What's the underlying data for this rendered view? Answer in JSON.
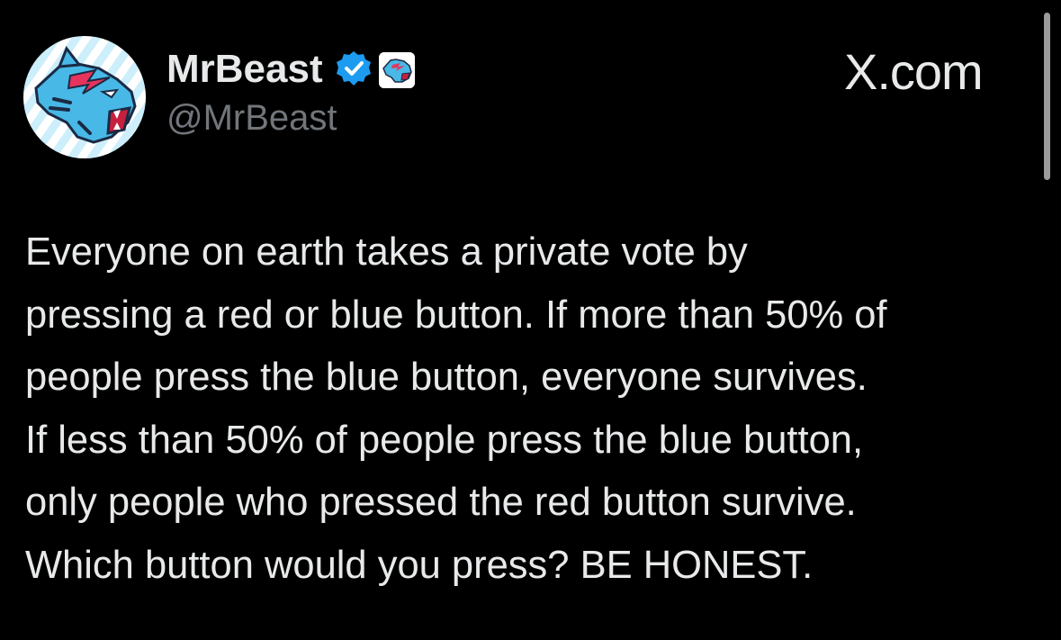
{
  "author": {
    "display_name": "MrBeast",
    "handle": "@MrBeast",
    "verified_icon": "verified-badge-icon",
    "affiliate_icon": "mrbeast-logo-icon",
    "avatar_icon": "mrbeast-panther-logo"
  },
  "site_label": "X.com",
  "tweet": {
    "lines": [
      "Everyone on earth takes a private vote by",
      "pressing a red or blue button. If more than 50% of",
      "people press the blue button, everyone survives.",
      "If less than 50% of people press the blue button,",
      "only people who pressed the red button survive.",
      "Which button would you press? BE HONEST."
    ]
  },
  "colors": {
    "background": "#000000",
    "text": "#e7e9ea",
    "muted": "#71767b",
    "verified": "#1d9bf0",
    "brand": "#48b8e6"
  }
}
